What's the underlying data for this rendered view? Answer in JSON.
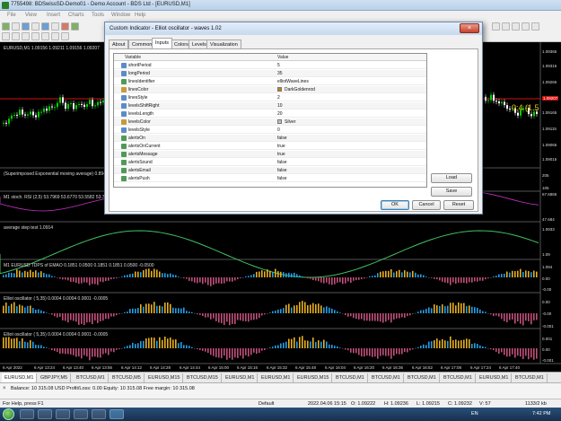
{
  "window": {
    "title": "7755498: BDSwissSD-Demo01 - Demo Account - BDS Ltd - [EURUSD,M1]"
  },
  "menu": [
    "File",
    "View",
    "Insert",
    "Charts",
    "Tools",
    "Window",
    "Help"
  ],
  "chart": {
    "main_label": "EURUSD,M1 1.09156 1.09211 1.09156 1.09207",
    "wave_label": "0:4 (1.5",
    "price_ticks": [
      "1.09365",
      "1.09315",
      "1.09265",
      "1.09207",
      "1.09165",
      "1.09115",
      "1.09065",
      "1.09015"
    ],
    "panes": [
      {
        "label": "(Superimposed Exponential moving average) 0.8948 (Ref...",
        "right": [
          "205",
          "-",
          "105"
        ]
      },
      {
        "label": "M1 stoch. RSI (2,5) 53.7969 53.6770 53.5582 53.7961 ...",
        "right": [
          "67.6865",
          "47.684"
        ]
      },
      {
        "label": "average step test 1.0914",
        "right": [
          "1.0933",
          "1.09"
        ]
      },
      {
        "label": "M1 EURUSD TDPS of EMAO 0.1851 0.0500 0.1851 0.1851 0.0500 -0.0500",
        "right": [
          "1.094",
          "0.00",
          "-0.00"
        ]
      },
      {
        "label": "Elliot oscillator ( 5,35) 0.0004 0.0004 0.0001 -0.0005",
        "right": [
          "0.00",
          "-0.00",
          "-0.001"
        ]
      },
      {
        "label": "Elliot oscillator ( 5,35) 0.0004 0.0004 0.0001 -0.0005",
        "right": [
          "0.001",
          "0.00",
          "-0.001"
        ]
      }
    ],
    "time_ticks": [
      "6 Apr 2022",
      "6 Apr 13:24",
      "6 Apr 13:40",
      "6 Apr 13:56",
      "6 Apr 14:12",
      "6 Apr 14:28",
      "6 Apr 14:44",
      "6 Apr 15:00",
      "6 Apr 15:16",
      "6 Apr 15:32",
      "6 Apr 15:48",
      "6 Apr 16:04",
      "6 Apr 16:20",
      "6 Apr 16:36",
      "6 Apr 16:52",
      "6 Apr 17:08",
      "6 Apr 17:24",
      "6 Apr 17:40"
    ],
    "colors": {
      "bull": "#00d000",
      "bear": "#ffffff",
      "level_line": "#d01010",
      "osc_up": "#26a0e8",
      "osc_dn": "#c0507a",
      "osc_mid": "#e8b020",
      "avg_line": "#40c060",
      "avg_line2": "#e07a20",
      "stoch": "#cc33cc"
    }
  },
  "symbol_tabs": [
    "EURUSD,M1",
    "GBPJPY,M5",
    "BTCUSD,M1",
    "BTCUSD,M5",
    "EURUSD,M15",
    "BTCUSD,M15",
    "EURUSD,M1",
    "EURUSD,M1",
    "EURUSD,M15",
    "BTCUSD,M1",
    "BTCUSD,M1",
    "BTCUSD,M1",
    "BTCUSD,M1",
    "EURUSD,M1",
    "BTCUSD,M1"
  ],
  "terminal": {
    "balance_line": "Balance: 10 315.08 USD  Profit/Loss: 0.00  Equity: 10 315.08  Free margin: 10 315.08"
  },
  "status": {
    "help": "For Help, press F1",
    "profile": "Default",
    "datetime": "2022.04.06 15:15",
    "open": "O: 1.09222",
    "high": "H: 1.09236",
    "low": "L: 1.09215",
    "close": "C: 1.09232",
    "volume": "V: 57",
    "traffic": "1133/2 kb"
  },
  "taskbar": {
    "lang": "EN",
    "time": "7:42 PM"
  },
  "dialog": {
    "title": "Custom Indicator - Elliot oscillator - waves 1.02",
    "tabs": [
      "About",
      "Common",
      "Inputs",
      "Colors",
      "Levels",
      "Visualization"
    ],
    "active_tab": "Inputs",
    "col_variable": "Variable",
    "col_value": "Value",
    "params": [
      {
        "name": "shortPeriod",
        "value": "5",
        "kind": "int"
      },
      {
        "name": "longPeriod",
        "value": "35",
        "kind": "int"
      },
      {
        "name": "linesIdentifier",
        "value": "elliotWaveLines",
        "kind": "str"
      },
      {
        "name": "linesColor",
        "value": "DarkGoldenrod",
        "kind": "col",
        "swatch": "#b8860b"
      },
      {
        "name": "linesStyle",
        "value": "2",
        "kind": "int"
      },
      {
        "name": "levelsShiftRight",
        "value": "10",
        "kind": "int"
      },
      {
        "name": "levelsLength",
        "value": "20",
        "kind": "int"
      },
      {
        "name": "levelsColor",
        "value": "Silver",
        "kind": "col",
        "swatch": "#c0c0c0"
      },
      {
        "name": "levelsStyle",
        "value": "0",
        "kind": "int"
      },
      {
        "name": "alertsOn",
        "value": "false",
        "kind": "bool"
      },
      {
        "name": "alertsOnCurrent",
        "value": "true",
        "kind": "bool"
      },
      {
        "name": "alertsMessage",
        "value": "true",
        "kind": "bool"
      },
      {
        "name": "alertsSound",
        "value": "false",
        "kind": "bool"
      },
      {
        "name": "alertsEmail",
        "value": "false",
        "kind": "bool"
      },
      {
        "name": "alertsPush",
        "value": "false",
        "kind": "bool"
      }
    ],
    "load_label": "Load",
    "save_label": "Save",
    "ok_label": "OK",
    "cancel_label": "Cancel",
    "reset_label": "Reset"
  }
}
